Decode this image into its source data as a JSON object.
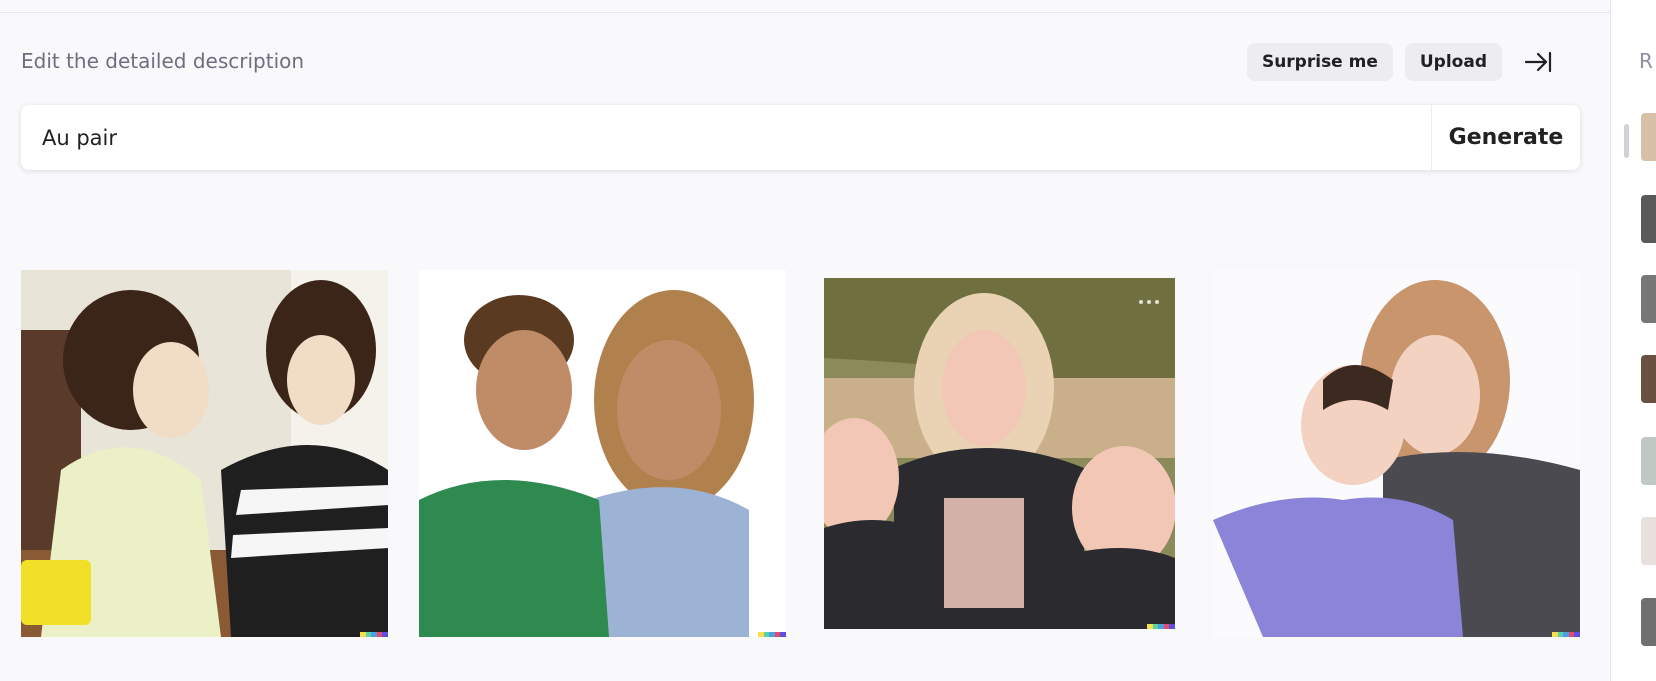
{
  "header": {
    "subheading": "Edit the detailed description",
    "surprise_label": "Surprise me",
    "upload_label": "Upload",
    "collapse_icon": "arrow-right-to-bar-icon"
  },
  "prompt": {
    "value": "Au pair",
    "generate_label": "Generate"
  },
  "results": [
    {
      "label": "generated-image-1",
      "colors": [
        "#e9e4d8",
        "#3b2418",
        "#f1dcc5",
        "#ecf0c6",
        "#1f1f1f",
        "#f2df27",
        "#8a5a35"
      ]
    },
    {
      "label": "generated-image-2",
      "colors": [
        "#ffffff",
        "#5b3a22",
        "#c08c68",
        "#2f8a4f",
        "#9db3d6",
        "#b0814d"
      ]
    },
    {
      "label": "generated-image-3",
      "colors": [
        "#8a8a5a",
        "#e9d3b4",
        "#2b2b2f",
        "#c9b08a",
        "#f3c7b5",
        "#d3b1a8"
      ]
    },
    {
      "label": "generated-image-4",
      "colors": [
        "#fbfbfd",
        "#c8956c",
        "#f4d2c2",
        "#8b84d8",
        "#4a4a50",
        "#3c2a20"
      ]
    }
  ],
  "sidebar": {
    "label": "R",
    "thumbnails": [
      "#d8c0a8",
      "#5a5a5a",
      "#777777",
      "#6a5040",
      "#c0c8c4",
      "#e8e0dc",
      "#707070"
    ]
  }
}
